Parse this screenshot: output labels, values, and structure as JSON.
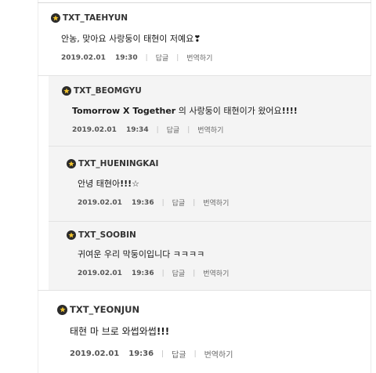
{
  "comments": [
    {
      "author": "TXT_TAEHYUN",
      "text": "안농, 맞아요 사랑둥이 태현이 저예요❣",
      "date": "2019.02.01",
      "time": "19:30",
      "reply_label": "답글",
      "translate_label": "번역하기"
    },
    {
      "author": "TXT_BEOMGYU",
      "text_bold": "Tomorrow X Together",
      "text_rest": " 의 사랑둥이 태현이가 왔어요",
      "text_tail": "!!!!",
      "date": "2019.02.01",
      "time": "19:34",
      "reply_label": "답글",
      "translate_label": "번역하기"
    },
    {
      "author": "TXT_HUENINGKAI",
      "text_main": "안녕 태현아",
      "text_tail": "!!!☆",
      "date": "2019.02.01",
      "time": "19:36",
      "reply_label": "답글",
      "translate_label": "번역하기"
    },
    {
      "author": "TXT_SOOBIN",
      "text": "귀여운 우리 막둥이입니다 ㅋㅋㅋㅋ",
      "date": "2019.02.01",
      "time": "19:36",
      "reply_label": "답글",
      "translate_label": "번역하기"
    },
    {
      "author": "TXT_YEONJUN",
      "text_main": "태현 마 브로 와썹와썹",
      "text_tail": "!!!",
      "date": "2019.02.01",
      "time": "19:36",
      "reply_label": "답글",
      "translate_label": "번역하기"
    }
  ],
  "icons": {
    "badge": "star-badge-icon"
  },
  "colors": {
    "reply_bg": "#f4f4f4",
    "text": "#1a1a1a",
    "meta": "#666666",
    "badge": "#2b2b2b"
  }
}
